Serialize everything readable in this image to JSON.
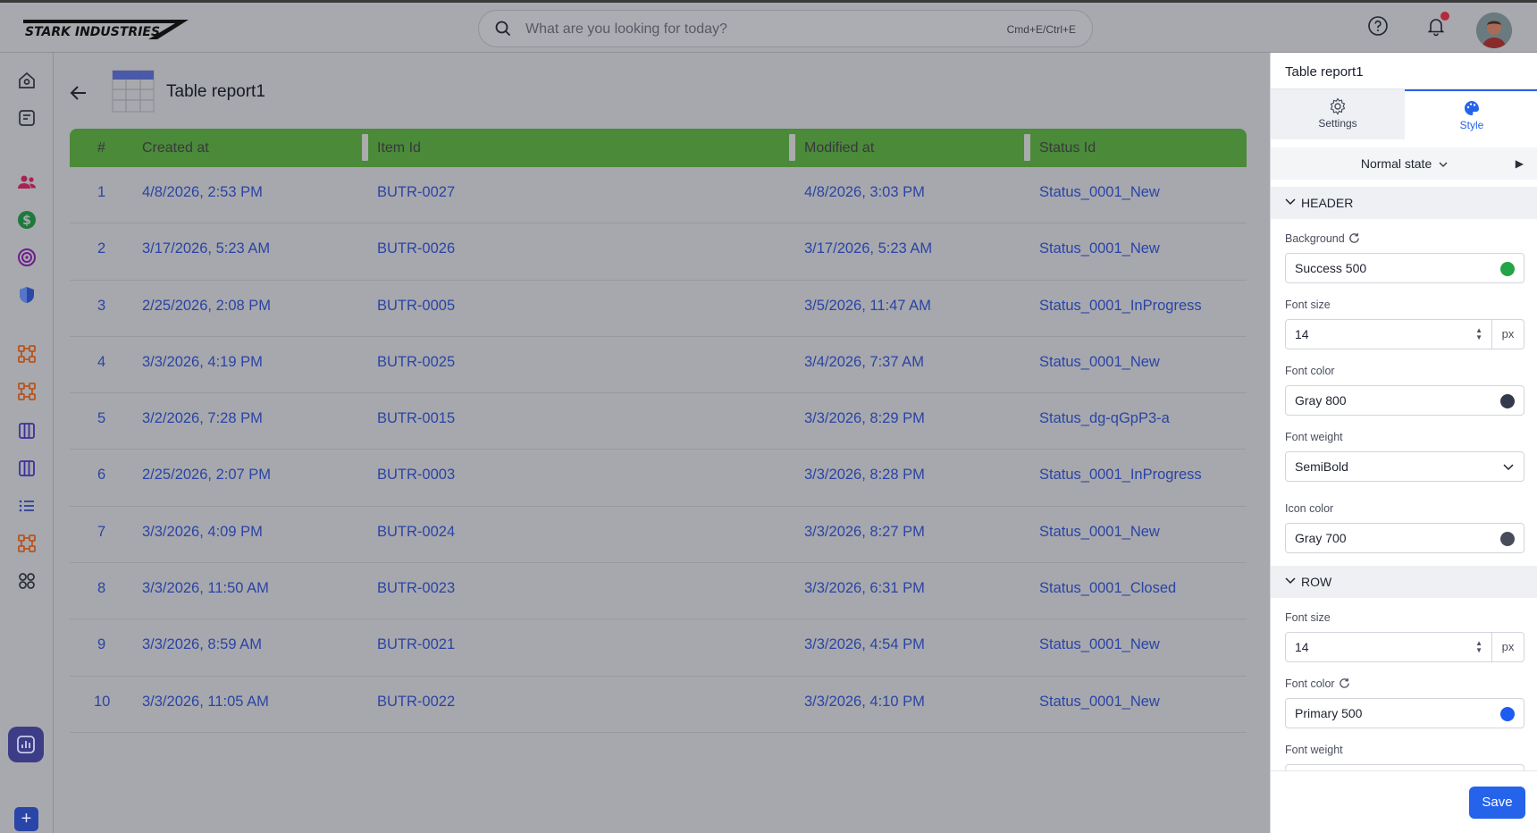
{
  "brand": {
    "logo_text": "STARK INDUSTRIES"
  },
  "search": {
    "placeholder": "What are you looking for today?",
    "shortcut": "Cmd+E/Ctrl+E"
  },
  "page": {
    "title": "Table report1"
  },
  "table": {
    "columns": [
      "#",
      "Created at",
      "Item Id",
      "Modified at",
      "Status Id"
    ],
    "rows": [
      [
        "1",
        "4/8/2026, 2:53 PM",
        "BUTR-0027",
        "4/8/2026, 3:03 PM",
        "Status_0001_New"
      ],
      [
        "2",
        "3/17/2026, 5:23 AM",
        "BUTR-0026",
        "3/17/2026, 5:23 AM",
        "Status_0001_New"
      ],
      [
        "3",
        "2/25/2026, 2:08 PM",
        "BUTR-0005",
        "3/5/2026, 11:47 AM",
        "Status_0001_InProgress"
      ],
      [
        "4",
        "3/3/2026, 4:19 PM",
        "BUTR-0025",
        "3/4/2026, 7:37 AM",
        "Status_0001_New"
      ],
      [
        "5",
        "3/2/2026, 7:28 PM",
        "BUTR-0015",
        "3/3/2026, 8:29 PM",
        "Status_dg-qGpP3-a"
      ],
      [
        "6",
        "2/25/2026, 2:07 PM",
        "BUTR-0003",
        "3/3/2026, 8:28 PM",
        "Status_0001_InProgress"
      ],
      [
        "7",
        "3/3/2026, 4:09 PM",
        "BUTR-0024",
        "3/3/2026, 8:27 PM",
        "Status_0001_New"
      ],
      [
        "8",
        "3/3/2026, 11:50 AM",
        "BUTR-0023",
        "3/3/2026, 6:31 PM",
        "Status_0001_Closed"
      ],
      [
        "9",
        "3/3/2026, 8:59 AM",
        "BUTR-0021",
        "3/3/2026, 4:54 PM",
        "Status_0001_New"
      ],
      [
        "10",
        "3/3/2026, 11:05 AM",
        "BUTR-0022",
        "3/3/2026, 4:10 PM",
        "Status_0001_New"
      ]
    ],
    "header_color": "#4a8a39",
    "cell_color": "#2a44a6"
  },
  "panel": {
    "title": "Table report1",
    "tabs": {
      "settings": "Settings",
      "style": "Style"
    },
    "state": "Normal state",
    "header_section": {
      "title": "HEADER",
      "background_label": "Background",
      "background_value": "Success 500",
      "background_color": "#22a447",
      "font_size_label": "Font size",
      "font_size_value": "14",
      "unit": "px",
      "font_color_label": "Font color",
      "font_color_value": "Gray 800",
      "font_color_swatch": "#343a4d",
      "font_weight_label": "Font weight",
      "font_weight_value": "SemiBold",
      "icon_color_label": "Icon color",
      "icon_color_value": "Gray 700",
      "icon_color_swatch": "#474c5a"
    },
    "row_section": {
      "title": "ROW",
      "font_size_label": "Font size",
      "font_size_value": "14",
      "unit": "px",
      "font_color_label": "Font color",
      "font_color_value": "Primary 500",
      "font_color_swatch": "#1d5cf0",
      "font_weight_label": "Font weight"
    },
    "save_label": "Save"
  }
}
